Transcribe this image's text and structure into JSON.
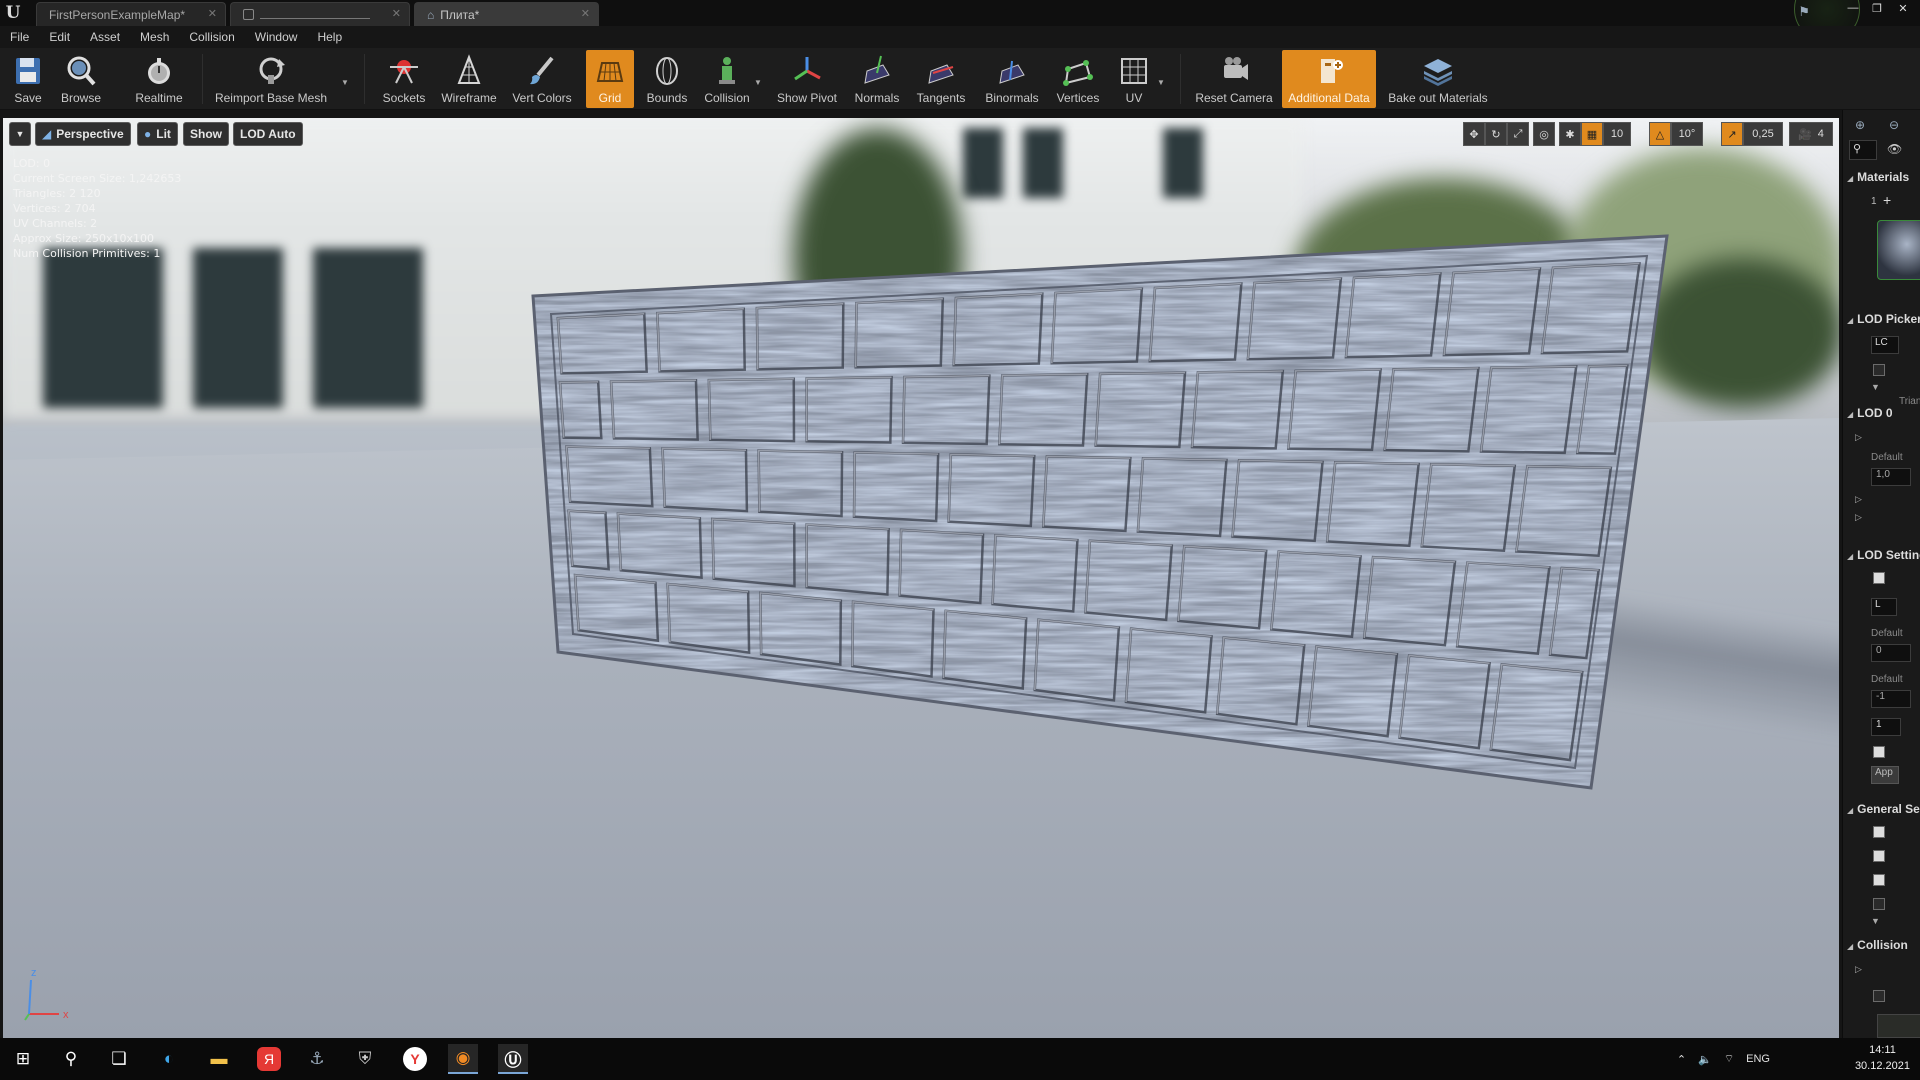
{
  "titlebar": {
    "tabs": [
      {
        "label": "FirstPersonExampleMap*"
      },
      {
        "label": ""
      },
      {
        "label": "Плита*"
      }
    ]
  },
  "menu": [
    "File",
    "Edit",
    "Asset",
    "Mesh",
    "Collision",
    "Window",
    "Help"
  ],
  "toolbar": {
    "save": "Save",
    "browse": "Browse",
    "realtime": "Realtime",
    "reimport": "Reimport Base Mesh",
    "sockets": "Sockets",
    "wireframe": "Wireframe",
    "vert_colors": "Vert Colors",
    "grid": "Grid",
    "bounds": "Bounds",
    "collision": "Collision",
    "show_pivot": "Show Pivot",
    "normals": "Normals",
    "tangents": "Tangents",
    "binormals": "Binormals",
    "vertices": "Vertices",
    "uv": "UV",
    "reset_camera": "Reset Camera",
    "additional_data": "Additional Data",
    "bake_out": "Bake out Materials",
    "accent_color": "#e08a1e"
  },
  "viewport": {
    "perspective": "Perspective",
    "lit": "Lit",
    "show": "Show",
    "lod_auto": "LOD Auto",
    "grid_snap": "10",
    "rot_snap": "10°",
    "scale_snap": "0,25",
    "cam_speed": "4",
    "stats": [
      "LOD:  0",
      "Current Screen Size:  1,242653",
      "Triangles:  2 120",
      "Vertices:  2 704",
      "UV Channels:  2",
      "Approx Size: 250x10x100",
      "Num Collision Primitives:  1"
    ],
    "axis_x": "x",
    "axis_z": "z"
  },
  "details": {
    "materials": "Materials",
    "material_index": "1",
    "lod_picker": "LOD Picker",
    "lod_dropdown": "LC",
    "triangles": "Triangles",
    "lod0": "LOD 0",
    "default1": "Default",
    "value1": "1,0",
    "lod_settings": "LOD Settings",
    "lod_dropdown2": "L",
    "default2": "Default",
    "value2": "0",
    "default3": "Default",
    "value3": "-1",
    "value4": "1",
    "apply": "App",
    "general": "General Settings",
    "collision": "Collision"
  },
  "taskbar": {
    "lang": "ENG",
    "time": "14:11",
    "date": "30.12.2021"
  }
}
